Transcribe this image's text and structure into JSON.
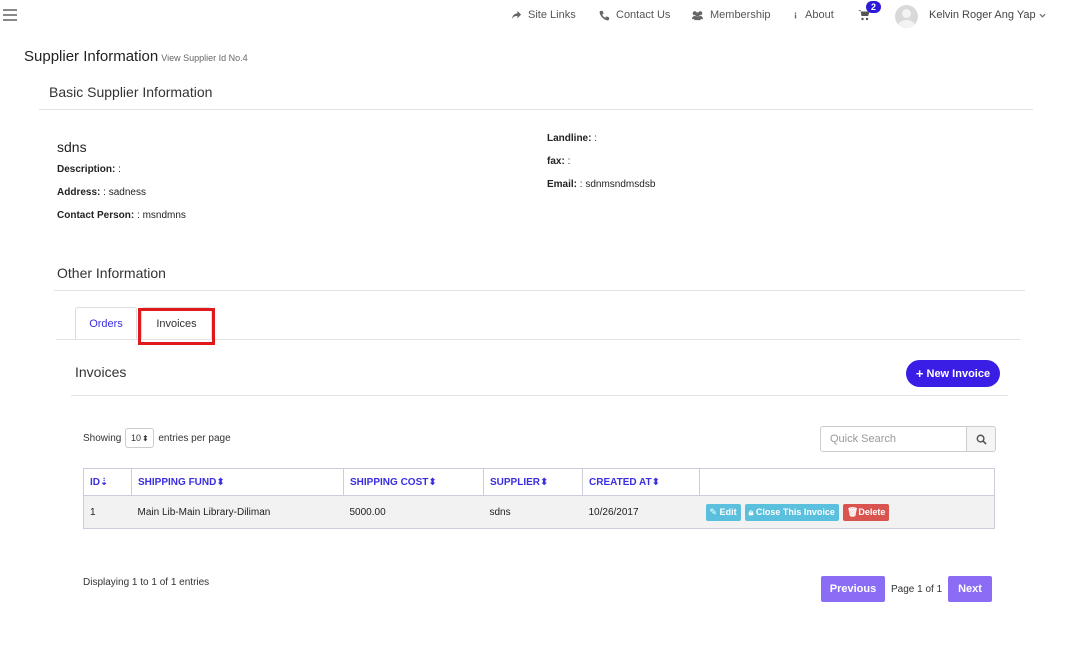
{
  "topnav": {
    "site_links": "Site Links",
    "contact_us": "Contact Us",
    "membership": "Membership",
    "about": "About",
    "cart_count": "2",
    "user_name": "Kelvin Roger Ang Yap"
  },
  "page": {
    "title": "Supplier Information",
    "subtitle": "View Supplier Id No.4"
  },
  "basic": {
    "heading": "Basic Supplier Information",
    "name": "sdns",
    "description_label": "Description:",
    "description_value": ":",
    "address_label": "Address:",
    "address_value": ": sadness",
    "contact_label": "Contact Person:",
    "contact_value": ": msndmns",
    "landline_label": "Landline:",
    "landline_value": ":",
    "fax_label": "fax:",
    "fax_value": ":",
    "email_label": "Email:",
    "email_value": ": sdnmsndmsdsb"
  },
  "other": {
    "heading": "Other Information",
    "tabs": [
      "Orders",
      "Invoices"
    ]
  },
  "invoices": {
    "heading": "Invoices",
    "new_button": "New Invoice",
    "showing_label": "Showing",
    "per_page": "10",
    "entries_label": "entries per page",
    "search_placeholder": "Quick Search",
    "columns": [
      "ID",
      "SHIPPING FUND",
      "SHIPPING COST",
      "SUPPLIER",
      "CREATED AT"
    ],
    "rows": [
      {
        "id": "1",
        "shipping_fund": "Main Lib-Main Library-Diliman",
        "shipping_cost": "5000.00",
        "supplier": "sdns",
        "created_at": "10/26/2017"
      }
    ],
    "actions": {
      "edit": "Edit",
      "close": "Close This Invoice",
      "delete": "Delete"
    },
    "displaying": "Displaying 1 to 1 of 1 entries",
    "previous": "Previous",
    "page_info": "Page 1 of 1",
    "next": "Next"
  },
  "colors": {
    "accent": "#3a1ee6",
    "link": "#3a2ee0",
    "highlight": "#e0191b",
    "pager": "#8b6cf5",
    "info": "#5bc0de",
    "danger": "#d9534f"
  }
}
